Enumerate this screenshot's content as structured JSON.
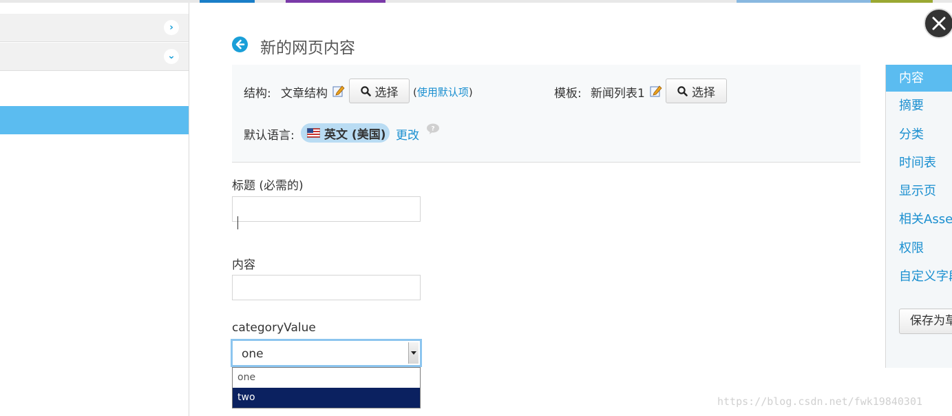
{
  "colors": {
    "accent": "#1a9fd8",
    "selected_bg": "#5bbcf0",
    "link": "#1a8fd0",
    "option_highlight": "#0b2160"
  },
  "header": {
    "title": "新的网页内容"
  },
  "structure": {
    "label": "结构:",
    "value": "文章结构",
    "select_label": "选择",
    "paren_open": "(",
    "default_link": "使用默认项",
    "paren_close": ")"
  },
  "template": {
    "label": "模板:",
    "value": "新闻列表1",
    "select_label": "选择"
  },
  "language": {
    "label": "默认语言:",
    "value": "英文 (美国)",
    "change_link": "更改"
  },
  "form": {
    "title_label": "标题 (必需的)",
    "title_value": "",
    "content_label": "内容",
    "content_value": "",
    "category_label": "categoryValue",
    "category_selected": "one",
    "category_options": [
      "one",
      "two"
    ],
    "highlighted_option": "two"
  },
  "right_nav": {
    "items": [
      "内容",
      "摘要",
      "分类",
      "时间表",
      "显示页",
      "相关Asset",
      "权限",
      "自定义字段"
    ],
    "active": "内容",
    "save_draft": "保存为草稿"
  },
  "watermark": "https://blog.csdn.net/fwk19840301"
}
